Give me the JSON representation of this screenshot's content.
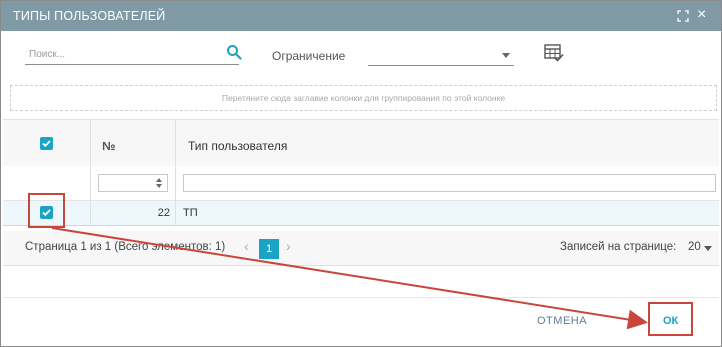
{
  "dialog": {
    "title": "ТИПЫ ПОЛЬЗОВАТЕЛЕЙ",
    "title_bar_color": "#7f9aa4",
    "icons": {
      "expand": "expand-icon",
      "close": "close-icon"
    }
  },
  "toolbar": {
    "search_placeholder": "Поиск...",
    "search_value": "",
    "filter_label": "Ограничение",
    "filter_value": "",
    "search_icon": "search-icon",
    "column_chooser_icon": "table-settings-icon"
  },
  "group_zone_text": "Перетяните сюда заглавие колонки для группирования по этой колонке",
  "grid": {
    "columns": [
      "",
      "№",
      "Тип пользователя"
    ],
    "select_all_checked": true,
    "rows": [
      {
        "checked": true,
        "num": "22",
        "type": "ТП"
      }
    ]
  },
  "pager": {
    "info": "Страница 1 из 1 (Всего элементов: 1)",
    "prev": "‹",
    "current_page": "1",
    "next": "›",
    "per_page_label": "Записей на странице:",
    "per_page_value": "20"
  },
  "footer": {
    "cancel_label": "ОТМЕНА",
    "ok_label": "ОК"
  },
  "colors": {
    "accent": "#1aa3c4",
    "highlight": "#c9463d"
  }
}
